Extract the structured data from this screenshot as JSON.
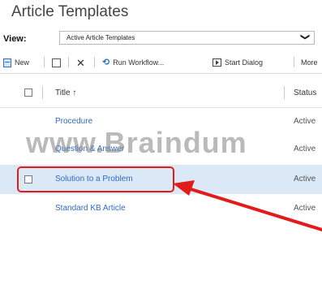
{
  "page": {
    "title": "Article Templates"
  },
  "view": {
    "label": "View:",
    "selected": "Active Article Templates",
    "chevron": "❯"
  },
  "toolbar": {
    "new_label": "New",
    "run_workflow_label": "Run Workflow...",
    "start_dialog_label": "Start Dialog",
    "more_label": "More"
  },
  "grid": {
    "columns": [
      {
        "label": "Title ↑"
      },
      {
        "label": "Status"
      }
    ],
    "rows": [
      {
        "title": "Procedure",
        "status": "Active"
      },
      {
        "title": "Question & Answer",
        "status": "Active"
      },
      {
        "title": "Solution to a Problem",
        "status": "Active"
      },
      {
        "title": "Standard KB Article",
        "status": "Active"
      }
    ]
  },
  "watermark": "www.Braindum",
  "colors": {
    "link": "#2f6bc2",
    "selected_row": "#dbe9f7",
    "annotation_red": "#e21b1b"
  },
  "icons": {
    "new": "new-record-icon",
    "copy": "copy-icon",
    "delete": "delete-x-icon",
    "workflow": "run-workflow-icon",
    "dialog": "start-dialog-icon"
  }
}
